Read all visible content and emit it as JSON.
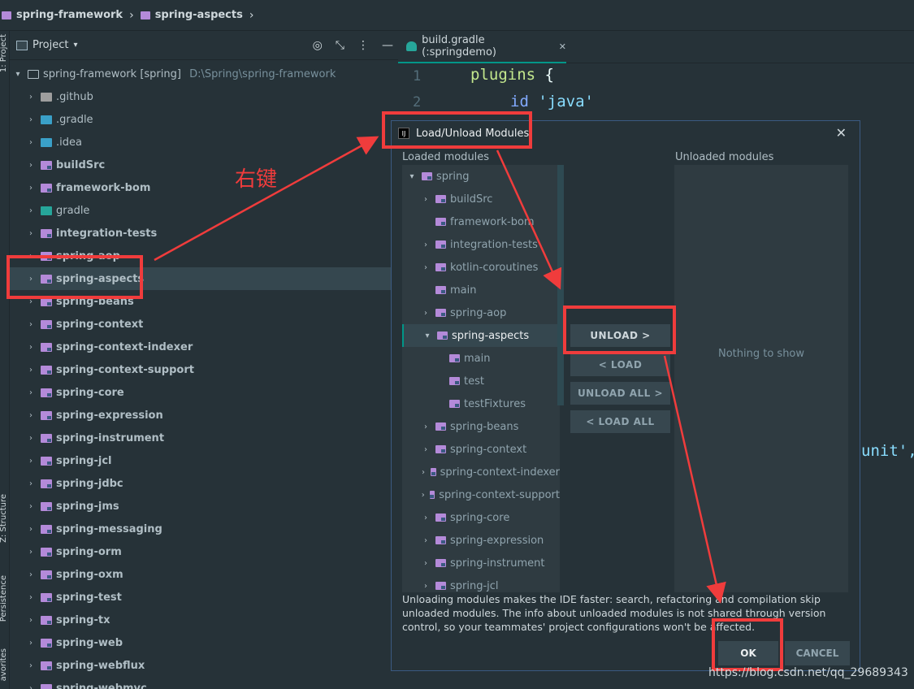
{
  "breadcrumb": {
    "items": [
      "spring-framework",
      "spring-aspects"
    ]
  },
  "toolstrip": {
    "project_label": "1: Project",
    "structure_label": "Z: Structure",
    "persistence_label": "Persistence",
    "favorites_label": "avorites"
  },
  "project_panel": {
    "title": "Project",
    "root": {
      "name": "spring-framework",
      "module": "[spring]",
      "path": "D:\\Spring\\spring-framework"
    },
    "items": [
      {
        "label": ".github",
        "icon": "plain",
        "bold": false
      },
      {
        "label": ".gradle",
        "icon": "blue",
        "bold": false
      },
      {
        "label": ".idea",
        "icon": "blue",
        "bold": false
      },
      {
        "label": "buildSrc",
        "icon": "mod",
        "bold": true
      },
      {
        "label": "framework-bom",
        "icon": "mod",
        "bold": true
      },
      {
        "label": "gradle",
        "icon": "teal",
        "bold": false
      },
      {
        "label": "integration-tests",
        "icon": "mod",
        "bold": true
      },
      {
        "label": "spring-aop",
        "icon": "mod",
        "bold": true
      },
      {
        "label": "spring-aspects",
        "icon": "mod",
        "bold": true
      },
      {
        "label": "spring-beans",
        "icon": "mod",
        "bold": true
      },
      {
        "label": "spring-context",
        "icon": "mod",
        "bold": true
      },
      {
        "label": "spring-context-indexer",
        "icon": "mod",
        "bold": true
      },
      {
        "label": "spring-context-support",
        "icon": "mod",
        "bold": true
      },
      {
        "label": "spring-core",
        "icon": "mod",
        "bold": true
      },
      {
        "label": "spring-expression",
        "icon": "mod",
        "bold": true
      },
      {
        "label": "spring-instrument",
        "icon": "mod",
        "bold": true
      },
      {
        "label": "spring-jcl",
        "icon": "mod",
        "bold": true
      },
      {
        "label": "spring-jdbc",
        "icon": "mod",
        "bold": true
      },
      {
        "label": "spring-jms",
        "icon": "mod",
        "bold": true
      },
      {
        "label": "spring-messaging",
        "icon": "mod",
        "bold": true
      },
      {
        "label": "spring-orm",
        "icon": "mod",
        "bold": true
      },
      {
        "label": "spring-oxm",
        "icon": "mod",
        "bold": true
      },
      {
        "label": "spring-test",
        "icon": "mod",
        "bold": true
      },
      {
        "label": "spring-tx",
        "icon": "mod",
        "bold": true
      },
      {
        "label": "spring-web",
        "icon": "mod",
        "bold": true
      },
      {
        "label": "spring-webflux",
        "icon": "mod",
        "bold": true
      },
      {
        "label": "spring-webmvc",
        "icon": "mod",
        "bold": true
      }
    ],
    "selected": "spring-aspects"
  },
  "editor": {
    "tab_label": "build.gradle (:springdemo)",
    "line_numbers": [
      "1",
      "2"
    ],
    "line1_keyword": "plugins",
    "line1_brace": "{",
    "line2_fn": "id",
    "line2_str": "'java'",
    "partial_text": "unit',"
  },
  "dialog": {
    "title": "Load/Unload Modules",
    "loaded_label": "Loaded modules",
    "unloaded_label": "Unloaded modules",
    "nothing_text": "Nothing to show",
    "loaded_items": [
      {
        "label": "spring",
        "arrow": "down",
        "indent": 0
      },
      {
        "label": "buildSrc",
        "arrow": "right",
        "indent": 1
      },
      {
        "label": "framework-bom",
        "arrow": "",
        "indent": 1
      },
      {
        "label": "integration-tests",
        "arrow": "right",
        "indent": 1
      },
      {
        "label": "kotlin-coroutines",
        "arrow": "right",
        "indent": 1
      },
      {
        "label": "main",
        "arrow": "",
        "indent": 1
      },
      {
        "label": "spring-aop",
        "arrow": "right",
        "indent": 1
      },
      {
        "label": "spring-aspects",
        "arrow": "down",
        "indent": 1
      },
      {
        "label": "main",
        "arrow": "",
        "indent": 2
      },
      {
        "label": "test",
        "arrow": "",
        "indent": 2
      },
      {
        "label": "testFixtures",
        "arrow": "",
        "indent": 2
      },
      {
        "label": "spring-beans",
        "arrow": "right",
        "indent": 1
      },
      {
        "label": "spring-context",
        "arrow": "right",
        "indent": 1
      },
      {
        "label": "spring-context-indexer",
        "arrow": "right",
        "indent": 1
      },
      {
        "label": "spring-context-support",
        "arrow": "right",
        "indent": 1
      },
      {
        "label": "spring-core",
        "arrow": "right",
        "indent": 1
      },
      {
        "label": "spring-expression",
        "arrow": "right",
        "indent": 1
      },
      {
        "label": "spring-instrument",
        "arrow": "right",
        "indent": 1
      },
      {
        "label": "spring-jcl",
        "arrow": "right",
        "indent": 1
      }
    ],
    "selected_item": "spring-aspects",
    "buttons": {
      "unload": "UNLOAD >",
      "load": "< LOAD",
      "unload_all": "UNLOAD ALL >",
      "load_all": "< LOAD ALL"
    },
    "info_text": "Unloading modules makes the IDE faster: search, refactoring and compilation skip unloaded modules. The info about unloaded modules is not shared through version control, so your teammates' project configurations won't be affected.",
    "ok_label": "OK",
    "cancel_label": "CANCEL"
  },
  "annotation": {
    "text": "右键",
    "color": "#f03c3c"
  },
  "watermark": "https://blog.csdn.net/qq_29689343",
  "colors": {
    "background": "#263238",
    "accent": "#009688",
    "module_folder": "#b48ad9",
    "annotation_red": "#f03c3c"
  }
}
